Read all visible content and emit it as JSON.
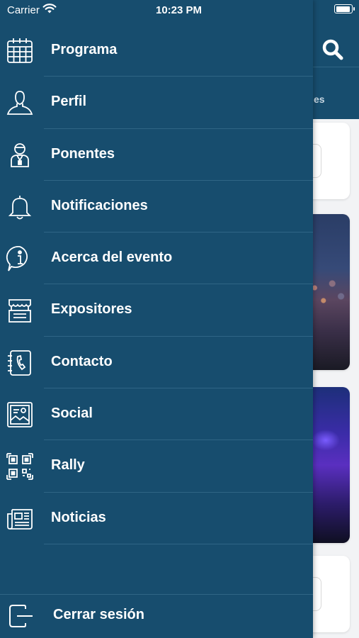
{
  "status_bar": {
    "carrier": "Carrier",
    "time": "10:23 PM"
  },
  "background_app": {
    "tab_label_fragment": "es",
    "search_icon": "search-icon"
  },
  "drawer": {
    "items": [
      {
        "label": "Programa",
        "icon": "calendar-icon"
      },
      {
        "label": "Perfil",
        "icon": "user-icon"
      },
      {
        "label": "Ponentes",
        "icon": "speaker-icon"
      },
      {
        "label": "Notificaciones",
        "icon": "bell-icon"
      },
      {
        "label": "Acerca del evento",
        "icon": "info-icon"
      },
      {
        "label": "Expositores",
        "icon": "booth-icon"
      },
      {
        "label": "Contacto",
        "icon": "phone-book-icon"
      },
      {
        "label": "Social",
        "icon": "social-photo-icon"
      },
      {
        "label": "Rally",
        "icon": "qr-code-icon"
      },
      {
        "label": "Noticias",
        "icon": "newspaper-icon"
      }
    ],
    "logout_label": "Cerrar sesión"
  },
  "colors": {
    "drawer_bg": "#174d6e",
    "separator": "#2f6585",
    "text": "#ffffff"
  }
}
